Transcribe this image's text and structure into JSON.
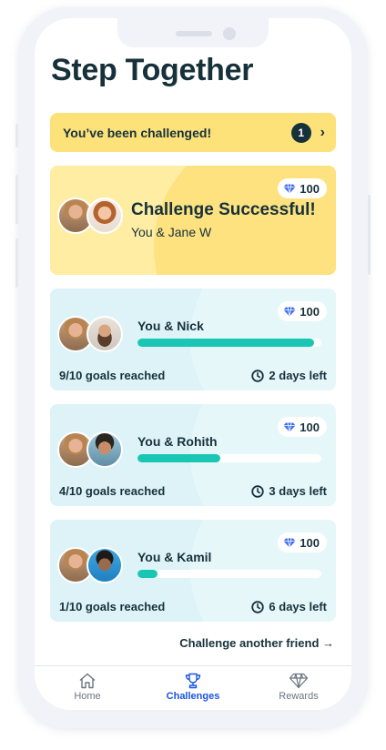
{
  "app": {
    "title": "Step Together"
  },
  "banner": {
    "text": "You’ve been challenged!",
    "count": "1",
    "chevron": "›"
  },
  "success_card": {
    "title": "Challenge Successful!",
    "subtitle": "You & Jane W",
    "gems": "100",
    "icon": "gem-icon",
    "color": "#feeda2"
  },
  "challenges": [
    {
      "name": "You & Nick",
      "progress": 0.96,
      "goals": "9/10 goals reached",
      "days": "2 days left",
      "gems": "100"
    },
    {
      "name": "You & Rohith",
      "progress": 0.45,
      "goals": "4/10 goals reached",
      "days": "3 days left",
      "gems": "100"
    },
    {
      "name": "You & Kamil",
      "progress": 0.11,
      "goals": "1/10 goals reached",
      "days": "6 days left",
      "gems": "100"
    }
  ],
  "link": {
    "text": "Challenge another friend →"
  },
  "tabs": [
    {
      "label": "Home",
      "icon": "home-icon",
      "active": false
    },
    {
      "label": "Challenges",
      "icon": "trophy-icon",
      "active": true
    },
    {
      "label": "Rewards",
      "icon": "diamond-icon",
      "active": false
    }
  ],
  "colors": {
    "accent": "#1a55e3",
    "progress": "#19c6b4",
    "banner": "#fde27a",
    "card_blue": "#ddf3f8",
    "text": "#17313b"
  }
}
